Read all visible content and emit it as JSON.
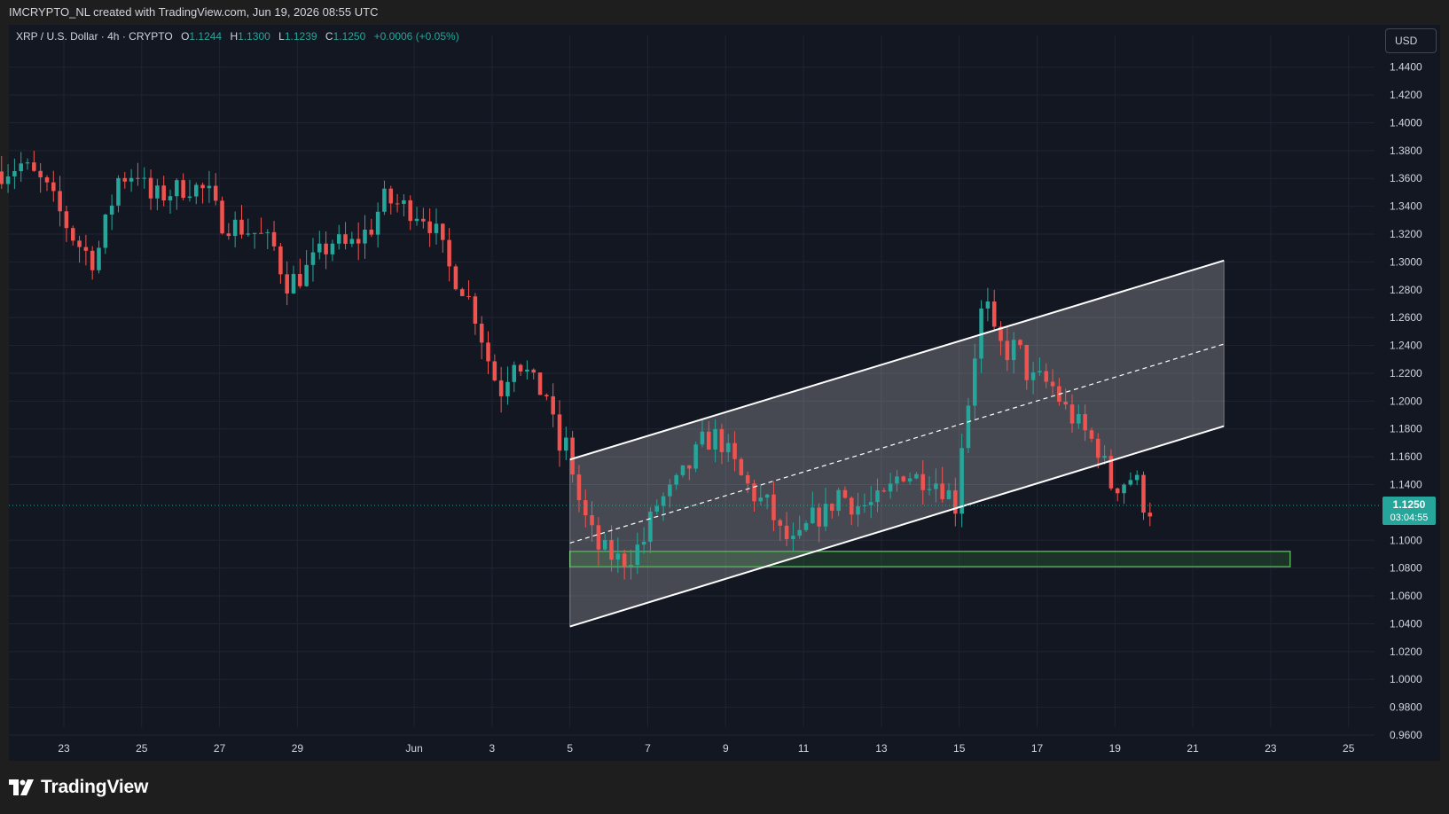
{
  "header": {
    "credit": "IMCRYPTO_NL created with TradingView.com, Jun 19, 2026 08:55 UTC"
  },
  "legend": {
    "symbol": "XRP / U.S. Dollar · 4h · CRYPTO",
    "o_label": "O",
    "o_value": "1.1244",
    "h_label": "H",
    "h_value": "1.1300",
    "l_label": "L",
    "l_value": "1.1239",
    "c_label": "C",
    "c_value": "1.1250",
    "change": "+0.0006 (+0.05%)"
  },
  "currency_button": "USD",
  "price_tag": {
    "price": "1.1250",
    "countdown": "03:04:55"
  },
  "footer": {
    "brand": "TradingView"
  },
  "colors": {
    "up": "#26a69a",
    "down": "#ef5350",
    "background": "#131722",
    "grid": "#1f2433",
    "zone": "#4caf50",
    "channel": "#ffffff"
  },
  "chart_data": {
    "type": "candlestick",
    "interval": "4h",
    "ylim": [
      0.96,
      1.45
    ],
    "y_ticks": [
      "1.4400",
      "1.4200",
      "1.4000",
      "1.3800",
      "1.3600",
      "1.3400",
      "1.3200",
      "1.3000",
      "1.2800",
      "1.2600",
      "1.2400",
      "1.2200",
      "1.2000",
      "1.1800",
      "1.1600",
      "1.1400",
      "1.1000",
      "1.0800",
      "1.0600",
      "1.0400",
      "1.0200",
      "1.0000",
      "0.9800",
      "0.9600"
    ],
    "x_ticks": [
      {
        "label": "23",
        "day": 23
      },
      {
        "label": "25",
        "day": 25
      },
      {
        "label": "27",
        "day": 27
      },
      {
        "label": "29",
        "day": 29
      },
      {
        "label": "Jun",
        "day": 32
      },
      {
        "label": "3",
        "day": 34
      },
      {
        "label": "5",
        "day": 36
      },
      {
        "label": "7",
        "day": 38
      },
      {
        "label": "9",
        "day": 40
      },
      {
        "label": "11",
        "day": 42
      },
      {
        "label": "13",
        "day": 44
      },
      {
        "label": "15",
        "day": 46
      },
      {
        "label": "17",
        "day": 48
      },
      {
        "label": "19",
        "day": 50
      },
      {
        "label": "21",
        "day": 52
      },
      {
        "label": "23",
        "day": 54
      },
      {
        "label": "25",
        "day": 56
      }
    ],
    "last_price": 1.125,
    "anchors": [
      [
        21.4,
        1.365
      ],
      [
        21.9,
        1.37
      ],
      [
        22.5,
        1.355
      ],
      [
        23.0,
        1.33
      ],
      [
        23.3,
        1.315
      ],
      [
        23.8,
        1.3
      ],
      [
        24.1,
        1.33
      ],
      [
        24.4,
        1.36
      ],
      [
        24.9,
        1.365
      ],
      [
        25.2,
        1.345
      ],
      [
        25.7,
        1.35
      ],
      [
        26.2,
        1.355
      ],
      [
        26.7,
        1.35
      ],
      [
        27.0,
        1.33
      ],
      [
        27.5,
        1.325
      ],
      [
        28.0,
        1.32
      ],
      [
        28.4,
        1.31
      ],
      [
        28.7,
        1.285
      ],
      [
        29.1,
        1.29
      ],
      [
        29.4,
        1.3
      ],
      [
        29.9,
        1.315
      ],
      [
        30.3,
        1.31
      ],
      [
        30.9,
        1.325
      ],
      [
        31.2,
        1.345
      ],
      [
        31.7,
        1.34
      ],
      [
        32.2,
        1.335
      ],
      [
        32.5,
        1.325
      ],
      [
        32.9,
        1.295
      ],
      [
        33.3,
        1.28
      ],
      [
        33.6,
        1.26
      ],
      [
        34.0,
        1.22
      ],
      [
        34.3,
        1.205
      ],
      [
        34.5,
        1.235
      ],
      [
        34.8,
        1.225
      ],
      [
        35.1,
        1.21
      ],
      [
        35.4,
        1.205
      ],
      [
        35.7,
        1.165
      ],
      [
        36.0,
        1.17
      ],
      [
        36.1,
        1.14
      ],
      [
        36.4,
        1.115
      ],
      [
        36.7,
        1.095
      ],
      [
        37.0,
        1.09
      ],
      [
        37.3,
        1.085
      ],
      [
        37.6,
        1.09
      ],
      [
        37.9,
        1.1
      ],
      [
        38.2,
        1.125
      ],
      [
        38.6,
        1.135
      ],
      [
        39.0,
        1.15
      ],
      [
        39.4,
        1.17
      ],
      [
        39.8,
        1.175
      ],
      [
        40.1,
        1.16
      ],
      [
        40.4,
        1.145
      ],
      [
        40.8,
        1.13
      ],
      [
        41.1,
        1.125
      ],
      [
        41.4,
        1.105
      ],
      [
        41.8,
        1.095
      ],
      [
        42.2,
        1.115
      ],
      [
        42.6,
        1.12
      ],
      [
        42.9,
        1.135
      ],
      [
        43.3,
        1.125
      ],
      [
        43.7,
        1.125
      ],
      [
        44.1,
        1.13
      ],
      [
        44.5,
        1.15
      ],
      [
        44.9,
        1.145
      ],
      [
        45.3,
        1.145
      ],
      [
        45.7,
        1.135
      ],
      [
        45.9,
        1.125
      ],
      [
        46.1,
        1.18
      ],
      [
        46.3,
        1.21
      ],
      [
        46.5,
        1.26
      ],
      [
        46.7,
        1.27
      ],
      [
        46.9,
        1.245
      ],
      [
        47.2,
        1.235
      ],
      [
        47.5,
        1.24
      ],
      [
        47.8,
        1.215
      ],
      [
        48.1,
        1.215
      ],
      [
        48.4,
        1.21
      ],
      [
        48.7,
        1.195
      ],
      [
        49.0,
        1.185
      ],
      [
        49.3,
        1.175
      ],
      [
        49.6,
        1.165
      ],
      [
        49.9,
        1.14
      ],
      [
        50.1,
        1.14
      ],
      [
        50.4,
        1.145
      ],
      [
        50.6,
        1.14
      ],
      [
        50.8,
        1.12
      ],
      [
        51.0,
        1.125
      ]
    ],
    "channel": {
      "upper": [
        [
          36.0,
          1.158
        ],
        [
          52.8,
          1.301
        ]
      ],
      "lower": [
        [
          36.0,
          1.038
        ],
        [
          52.8,
          1.182
        ]
      ],
      "mid": [
        [
          36.0,
          1.098
        ],
        [
          52.8,
          1.241
        ]
      ]
    },
    "zone": {
      "x0": 36.0,
      "x1": 54.5,
      "y0": 1.081,
      "y1": 1.092
    }
  }
}
